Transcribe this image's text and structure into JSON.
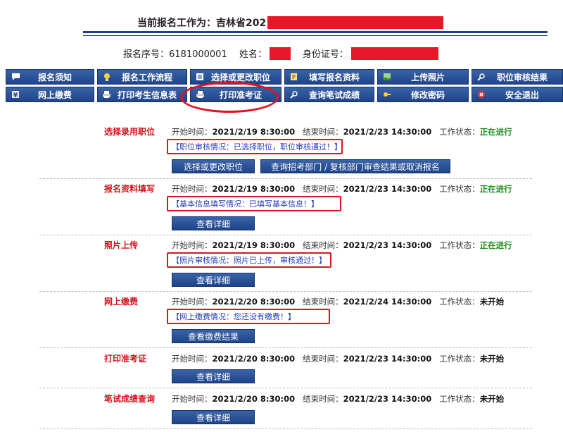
{
  "header": {
    "title": "当前报名工作为：吉林省202"
  },
  "info": {
    "serial_label": "报名序号：",
    "serial_value": "6181000001",
    "name_label": "姓名：",
    "id_label": "身份证号："
  },
  "nav": {
    "row1": [
      {
        "label": "报名须知",
        "icon": "speech-bubble-icon"
      },
      {
        "label": "报名工作流程",
        "icon": "lightbulb-icon"
      },
      {
        "label": "选择或更改职位",
        "icon": "list-icon"
      },
      {
        "label": "填写报名资料",
        "icon": "edit-icon"
      },
      {
        "label": "上传照片",
        "icon": "image-icon"
      },
      {
        "label": "职位审核结果",
        "icon": "magnifier-icon"
      }
    ],
    "row2": [
      {
        "label": "网上缴费",
        "icon": "yen-icon"
      },
      {
        "label": "打印考生信息表",
        "icon": "printer-icon"
      },
      {
        "label": "打印准考证",
        "icon": "printer-icon"
      },
      {
        "label": "查询笔试成绩",
        "icon": "magnifier-icon"
      },
      {
        "label": "修改密码",
        "icon": "key-icon"
      },
      {
        "label": "安全退出",
        "icon": "exit-icon"
      }
    ]
  },
  "labels": {
    "start": "开始时间：",
    "end": "结束时间：",
    "status": "工作状态："
  },
  "sections": [
    {
      "title": "选择录用职位",
      "start": "2021/2/19 8:30:00",
      "end": "2021/2/23 14:30:00",
      "status": "正在进行",
      "note": "【职位审核情况：已选择职位，职位审核通过！】",
      "buttons": [
        "选择或更改职位",
        "查询招考部门 / 复核部门审查结果或取消报名"
      ]
    },
    {
      "title": "报名资料填写",
      "start": "2021/2/19 8:30:00",
      "end": "2021/2/23 14:30:00",
      "status": "正在进行",
      "note": "【基本信息填写情况：已填写基本信息！】",
      "buttons": [
        "查看详细"
      ]
    },
    {
      "title": "照片上传",
      "start": "2021/2/19 8:30:00",
      "end": "2021/2/23 14:30:00",
      "status": "正在进行",
      "note": "【照片审核情况：照片已上传，审核通过！】",
      "buttons": [
        "查看详细"
      ]
    },
    {
      "title": "网上缴费",
      "start": "2021/2/20 8:30:00",
      "end": "2021/2/24 14:30:00",
      "status": "未开始",
      "note": "【网上缴费情况：您还没有缴费！】",
      "buttons": [
        "查看缴费结果"
      ]
    },
    {
      "title": "打印准考证",
      "start": "2021/2/20 8:30:00",
      "end": "2021/2/23 14:30:00",
      "status": "未开始",
      "buttons": [
        "查看详细"
      ]
    },
    {
      "title": "笔试成绩查询",
      "start": "2021/2/20 8:30:00",
      "end": "2021/2/23 14:30:00",
      "status": "未开始",
      "buttons": [
        "查看详细"
      ]
    }
  ],
  "colors": {
    "nav_blue": "#1f4489",
    "title_red": "#d2121b",
    "running_green": "#1e8b1e",
    "annotation_red": "#e0141e",
    "note_blue": "#2638b8"
  }
}
